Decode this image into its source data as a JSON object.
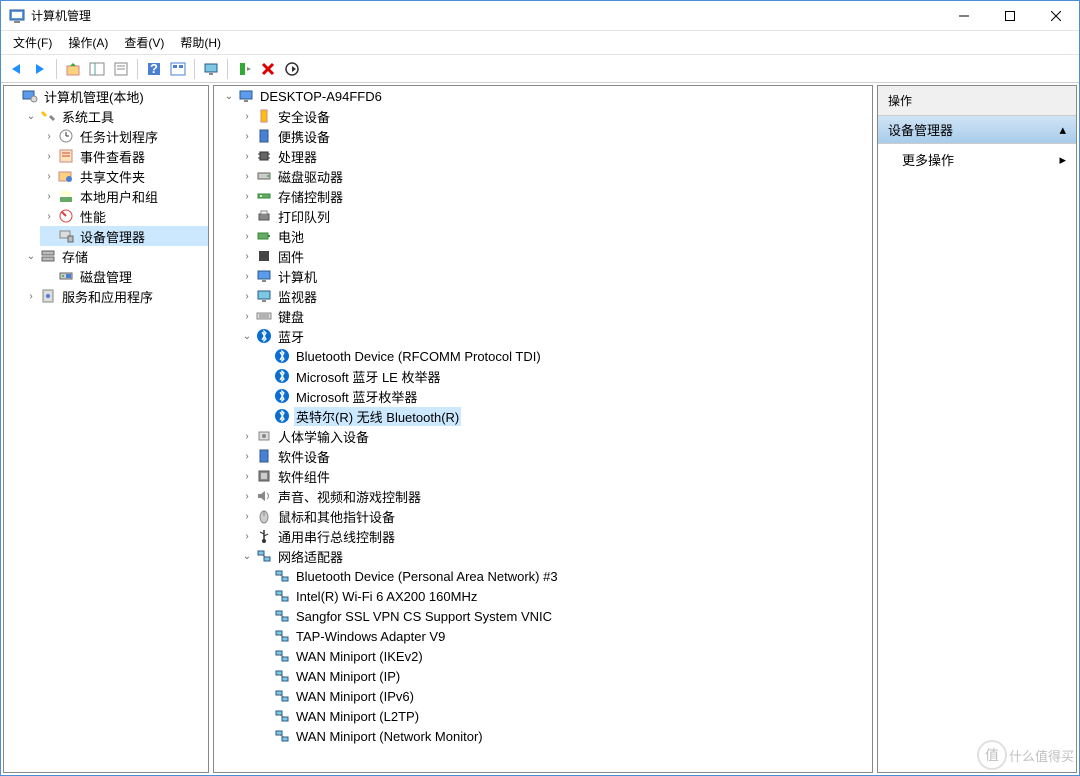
{
  "window": {
    "title": "计算机管理"
  },
  "menu": {
    "file": "文件(F)",
    "action": "操作(A)",
    "view": "查看(V)",
    "help": "帮助(H)"
  },
  "left_tree": {
    "root": "计算机管理(本地)",
    "system_tools": "系统工具",
    "task_scheduler": "任务计划程序",
    "event_viewer": "事件查看器",
    "shared_folders": "共享文件夹",
    "local_users": "本地用户和组",
    "performance": "性能",
    "device_manager": "设备管理器",
    "storage": "存储",
    "disk_management": "磁盘管理",
    "services": "服务和应用程序"
  },
  "mid_tree": {
    "computer": "DESKTOP-A94FFD6",
    "security": "安全设备",
    "portable": "便携设备",
    "cpu": "处理器",
    "disk_drives": "磁盘驱动器",
    "storage_ctrl": "存储控制器",
    "print_queue": "打印队列",
    "battery": "电池",
    "firmware": "固件",
    "computers": "计算机",
    "monitors": "监视器",
    "keyboards": "键盘",
    "bluetooth": "蓝牙",
    "bt1": "Bluetooth Device (RFCOMM Protocol TDI)",
    "bt2": "Microsoft 蓝牙 LE 枚举器",
    "bt3": "Microsoft 蓝牙枚举器",
    "bt4": "英特尔(R) 无线 Bluetooth(R)",
    "hid": "人体学输入设备",
    "soft_dev": "软件设备",
    "soft_comp": "软件组件",
    "sound": "声音、视频和游戏控制器",
    "mouse": "鼠标和其他指针设备",
    "usb": "通用串行总线控制器",
    "network": "网络适配器",
    "net1": "Bluetooth Device (Personal Area Network) #3",
    "net2": "Intel(R) Wi-Fi 6 AX200 160MHz",
    "net3": "Sangfor SSL VPN CS Support System VNIC",
    "net4": "TAP-Windows Adapter V9",
    "net5": "WAN Miniport (IKEv2)",
    "net6": "WAN Miniport (IP)",
    "net7": "WAN Miniport (IPv6)",
    "net8": "WAN Miniport (L2TP)",
    "net9": "WAN Miniport (Network Monitor)"
  },
  "actions": {
    "header": "操作",
    "category": "设备管理器",
    "more": "更多操作"
  },
  "watermark": {
    "badge": "值",
    "text": "什么值得买"
  }
}
